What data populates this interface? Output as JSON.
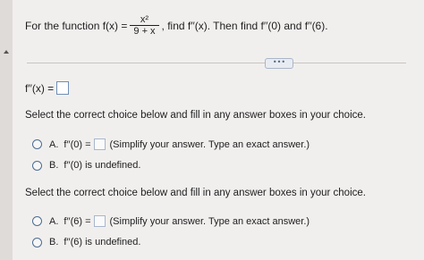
{
  "question": {
    "prefix": "For the function f(x) =",
    "numerator": "x²",
    "denominator": "9 + x",
    "suffix": ", find f′′(x). Then find f′′(0) and f′′(6)."
  },
  "more_button": "•••",
  "answer": {
    "label": "f′′(x) =",
    "value": ""
  },
  "part1": {
    "instruction": "Select the correct choice below and fill in any answer boxes in your choice.",
    "option_a": {
      "letter": "A.",
      "label": "f′′(0) =",
      "value": "",
      "hint": "(Simplify your answer. Type an exact answer.)"
    },
    "option_b": {
      "letter": "B.",
      "label": "f′′(0) is undefined."
    }
  },
  "part2": {
    "instruction": "Select the correct choice below and fill in any answer boxes in your choice.",
    "option_a": {
      "letter": "A.",
      "label": "f′′(6) =",
      "value": "",
      "hint": "(Simplify your answer. Type an exact answer.)"
    },
    "option_b": {
      "letter": "B.",
      "label": "f′′(6) is undefined."
    }
  }
}
